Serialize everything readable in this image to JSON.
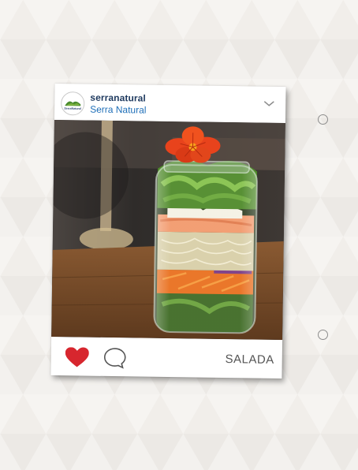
{
  "post": {
    "username": "serranatural",
    "display_name": "Serra Natural",
    "avatar_text": "SerraNatural",
    "tag": "SALADA"
  },
  "icons": {
    "menu": "chevron-down-icon",
    "like": "heart-icon",
    "comment": "speech-bubble-icon"
  },
  "colors": {
    "like": "#d7262e",
    "username": "#1f3a5f",
    "display_name": "#1f6fb8",
    "flower": "#e8431c"
  }
}
